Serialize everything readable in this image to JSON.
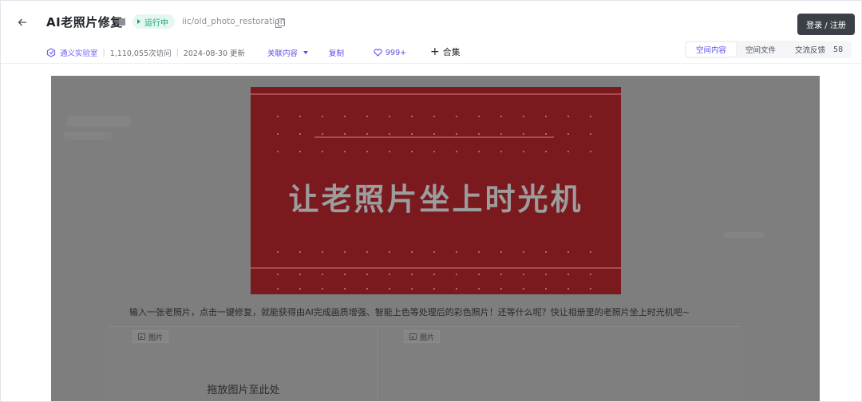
{
  "header": {
    "title": "AI老照片修复",
    "status": "运行中",
    "repo_path": "iic/old_photo_restoration",
    "login_label": "登录 / 注册"
  },
  "meta": {
    "org": "通义实验室",
    "visits": "1,110,055次访问",
    "updated": "2024-08-30 更新",
    "related_label": "关联内容",
    "copy_label": "复制",
    "likes": "999+",
    "collect_label": "合集"
  },
  "tabs": [
    {
      "label": "空间内容",
      "active": true
    },
    {
      "label": "空间文件",
      "active": false
    },
    {
      "label": "交流反馈",
      "count": "58",
      "active": false
    }
  ],
  "banner": {
    "text": "让老照片坐上时光机"
  },
  "description": "输入一张老照片，点击一键修复，就能获得由AI完成画质增强、智能上色等处理后的彩色照片！还等什么呢？快让相册里的老照片坐上时光机吧~",
  "panels": {
    "input_label": "图片",
    "output_label": "图片",
    "drop_hint": "拖放图片至此处"
  },
  "colors": {
    "accent": "#5b4fe8",
    "status_green": "#1aa37a",
    "login_bg": "#3b3f46",
    "banner_red": "#7a1a1f"
  },
  "icons": [
    "back-arrow-icon",
    "pin-icon",
    "play-icon",
    "copy-icon",
    "org-logo-icon",
    "chevron-down-icon",
    "heart-icon",
    "plus-icon",
    "image-icon"
  ]
}
